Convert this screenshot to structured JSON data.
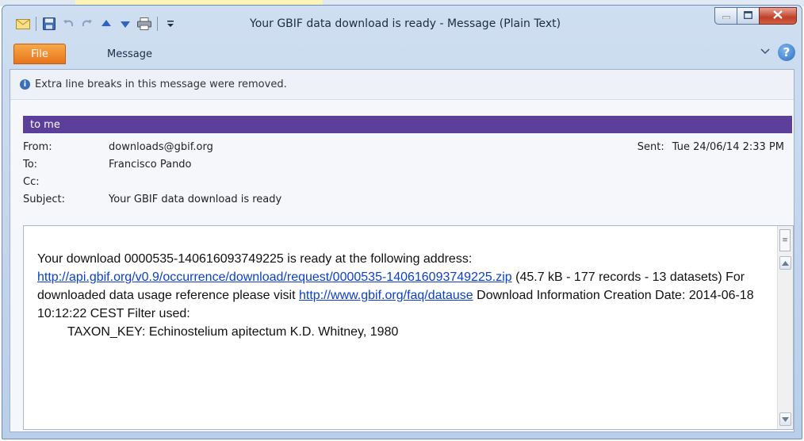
{
  "window": {
    "title": "Your GBIF data download is ready  -  Message (Plain Text)"
  },
  "ribbon": {
    "file_label": "File",
    "message_label": "Message"
  },
  "infobar": {
    "text": "Extra line breaks in this message were removed."
  },
  "header": {
    "sender_bar": "to me",
    "from_label": "From:",
    "from_value": "downloads@gbif.org",
    "to_label": "To:",
    "to_value": "Francisco Pando",
    "cc_label": "Cc:",
    "cc_value": "",
    "subject_label": "Subject:",
    "subject_value": "Your GBIF data download is ready",
    "sent_label": "Sent:",
    "sent_value": "Tue 24/06/14 2:33 PM"
  },
  "body": {
    "line1": "Your download 0000535-140616093749225 is ready at the following address:",
    "download_link": "http://api.gbif.org/v0.9/occurrence/download/request/0000535-140616093749225.zip",
    "after_link": " (45.7 kB - 177 records - 13 datasets)  For downloaded data usage reference please visit ",
    "datause_link": "http://www.gbif.org/faq/datause",
    "after_datause": " Download Information  Creation Date: 2014-06-18 10:12:22 CEST  Filter used:",
    "filter_line": "TAXON_KEY: Echinostelium apitectum K.D. Whitney, 1980"
  },
  "colors": {
    "sender_bar": "#5b3f9a",
    "file_tab": "#e8741b",
    "link": "#0b3fd0"
  },
  "icons": {
    "qat": [
      "envelope-icon",
      "save-icon",
      "undo-icon",
      "redo-icon",
      "up-arrow-icon",
      "down-arrow-icon",
      "print-icon",
      "customize-qat-icon"
    ],
    "ribbon": [
      "collapse-ribbon-icon",
      "help-icon"
    ],
    "window": [
      "minimize-icon",
      "maximize-icon",
      "close-icon"
    ]
  }
}
